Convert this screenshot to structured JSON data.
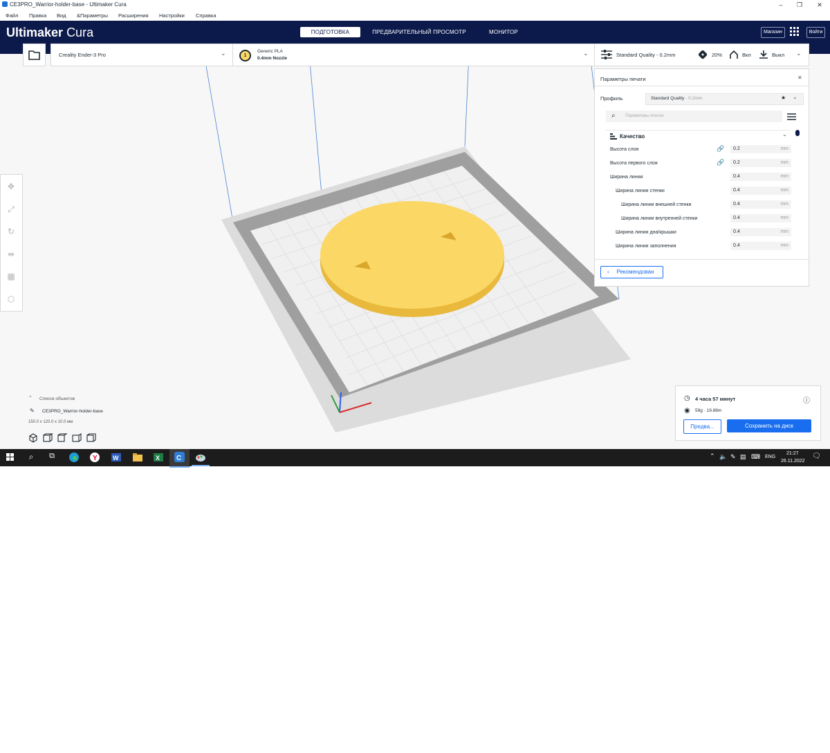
{
  "window": {
    "title": "CE3PRO_Warrior-holder-base - Ultimaker Cura",
    "minimize": "–",
    "restore": "❐",
    "close": "✕"
  },
  "menu": [
    "Файл",
    "Правка",
    "Вид",
    "&Параметры",
    "Расширения",
    "Настройки",
    "Справка"
  ],
  "header": {
    "brand_bold": "Ultimaker",
    "brand_light": "Cura",
    "stages": [
      "ПОДГОТОВКА",
      "ПРЕДВАРИТЕЛЬНЫЙ ПРОСМОТР",
      "МОНИТОР"
    ],
    "active_stage": 0,
    "marketplace": "Магазин",
    "signin": "Войти"
  },
  "printer": {
    "name": "Creality Ender-3 Pro",
    "extruder_number": "1",
    "material": "Generic PLA",
    "nozzle": "0.4mm Nozzle"
  },
  "print_summary": {
    "profile": "Standard Quality - 0.2mm",
    "infill": "20%",
    "support": "Вкл",
    "adhesion": "Выкл"
  },
  "settings_panel": {
    "title": "Параметры печати",
    "profile_label": "Профиль",
    "profile_value": "Standard Quality",
    "profile_suffix": " - 0.2mm",
    "search_placeholder": "Параметры поиска",
    "category": "Качество",
    "rows": [
      {
        "label": "Высота слоя",
        "value": "0.2",
        "unit": "mm",
        "indent": 0,
        "link": true
      },
      {
        "label": "Высота первого слоя",
        "value": "0.2",
        "unit": "mm",
        "indent": 0,
        "link": true
      },
      {
        "label": "Ширина линии",
        "value": "0.4",
        "unit": "mm",
        "indent": 0,
        "link": false
      },
      {
        "label": "Ширина линии стенки",
        "value": "0.4",
        "unit": "mm",
        "indent": 1,
        "link": false
      },
      {
        "label": "Ширина линии внешней стенки",
        "value": "0.4",
        "unit": "mm",
        "indent": 2,
        "link": false
      },
      {
        "label": "Ширина линии внутренней стенки",
        "value": "0.4",
        "unit": "mm",
        "indent": 2,
        "link": false
      },
      {
        "label": "Ширина линии дна/крышки",
        "value": "0.4",
        "unit": "mm",
        "indent": 1,
        "link": false
      },
      {
        "label": "Ширина линии заполнения",
        "value": "0.4",
        "unit": "mm",
        "indent": 1,
        "link": false
      }
    ],
    "recommended_button": "Рекомендован"
  },
  "object_list": {
    "header": "Список объектов",
    "item": "CE3PRO_Warrior-holder-base",
    "dimensions": "150.0 x 120.0 x 10.0 мм"
  },
  "estimate": {
    "time": "4 часа 57 минут",
    "material": "59g · 19.88m",
    "preview_button": "Предва...",
    "save_button": "Сохранить на диск"
  },
  "taskbar": {
    "language": "ENG",
    "time": "21:27",
    "date": "26.11.2022"
  },
  "colors": {
    "header": "#0c1a4b",
    "accent": "#196ef0",
    "model": "#fbd766",
    "taskbar": "#1c1c1c"
  }
}
